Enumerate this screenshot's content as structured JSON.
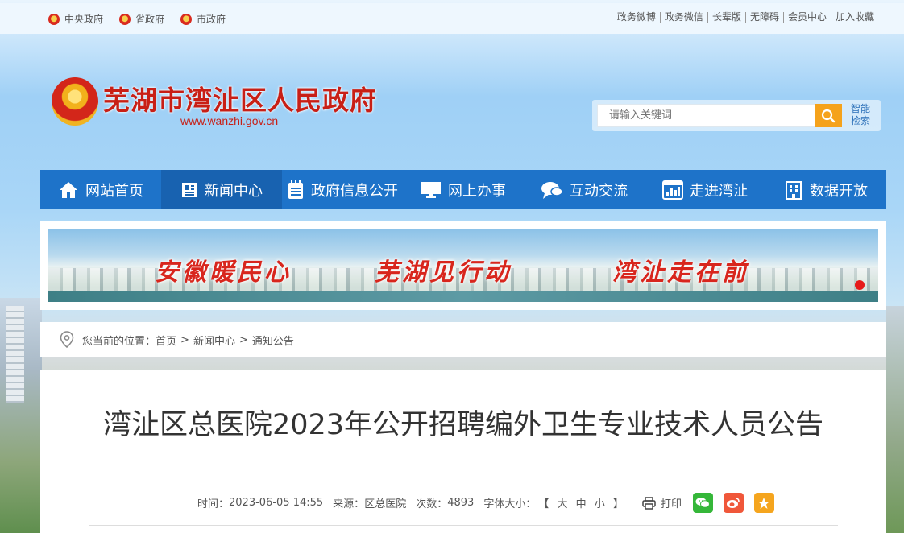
{
  "topbar": {
    "left_links": [
      "中央政府",
      "省政府",
      "市政府"
    ],
    "right_links": [
      "政务微博",
      "政务微信",
      "长辈版",
      "无障碍",
      "会员中心",
      "加入收藏"
    ]
  },
  "header": {
    "site_title": "芜湖市湾沚区人民政府",
    "site_url": "www.wanzhi.gov.cn"
  },
  "search": {
    "placeholder": "请输入关键词",
    "smart_search_line1": "智能",
    "smart_search_line2": "检索"
  },
  "nav": {
    "items": [
      {
        "label": "网站首页",
        "icon": "home-icon"
      },
      {
        "label": "新闻中心",
        "icon": "news-icon"
      },
      {
        "label": "政府信息公开",
        "icon": "document-list-icon"
      },
      {
        "label": "网上办事",
        "icon": "monitor-icon"
      },
      {
        "label": "互动交流",
        "icon": "chat-icon"
      },
      {
        "label": "走进湾沚",
        "icon": "bar-chart-icon"
      },
      {
        "label": "数据开放",
        "icon": "building-icon"
      }
    ],
    "active_index": 1
  },
  "banner": {
    "slogan1": "安徽暖民心",
    "slogan2": "芜湖见行动",
    "slogan3": "湾沚走在前"
  },
  "breadcrumb": {
    "prefix": "您当前的位置：",
    "items": [
      "首页",
      "新闻中心",
      "通知公告"
    ],
    "separator": ">"
  },
  "article": {
    "title": "湾沚区总医院2023年公开招聘编外卫生专业技术人员公告",
    "time_label": "时间：",
    "time": "2023-06-05 14:55",
    "source_label": "来源：",
    "source": "区总医院",
    "views_label": "次数：",
    "views": "4893",
    "font_size_label": "字体大小：",
    "font_open": "【",
    "font_large": "大",
    "font_medium": "中",
    "font_small": "小",
    "font_close": "】",
    "print_label": "打印"
  },
  "colors": {
    "nav_bg": "#1e73c9",
    "nav_active": "#1862b0",
    "title_red": "#c81f16",
    "search_btn": "#f5a21b"
  }
}
